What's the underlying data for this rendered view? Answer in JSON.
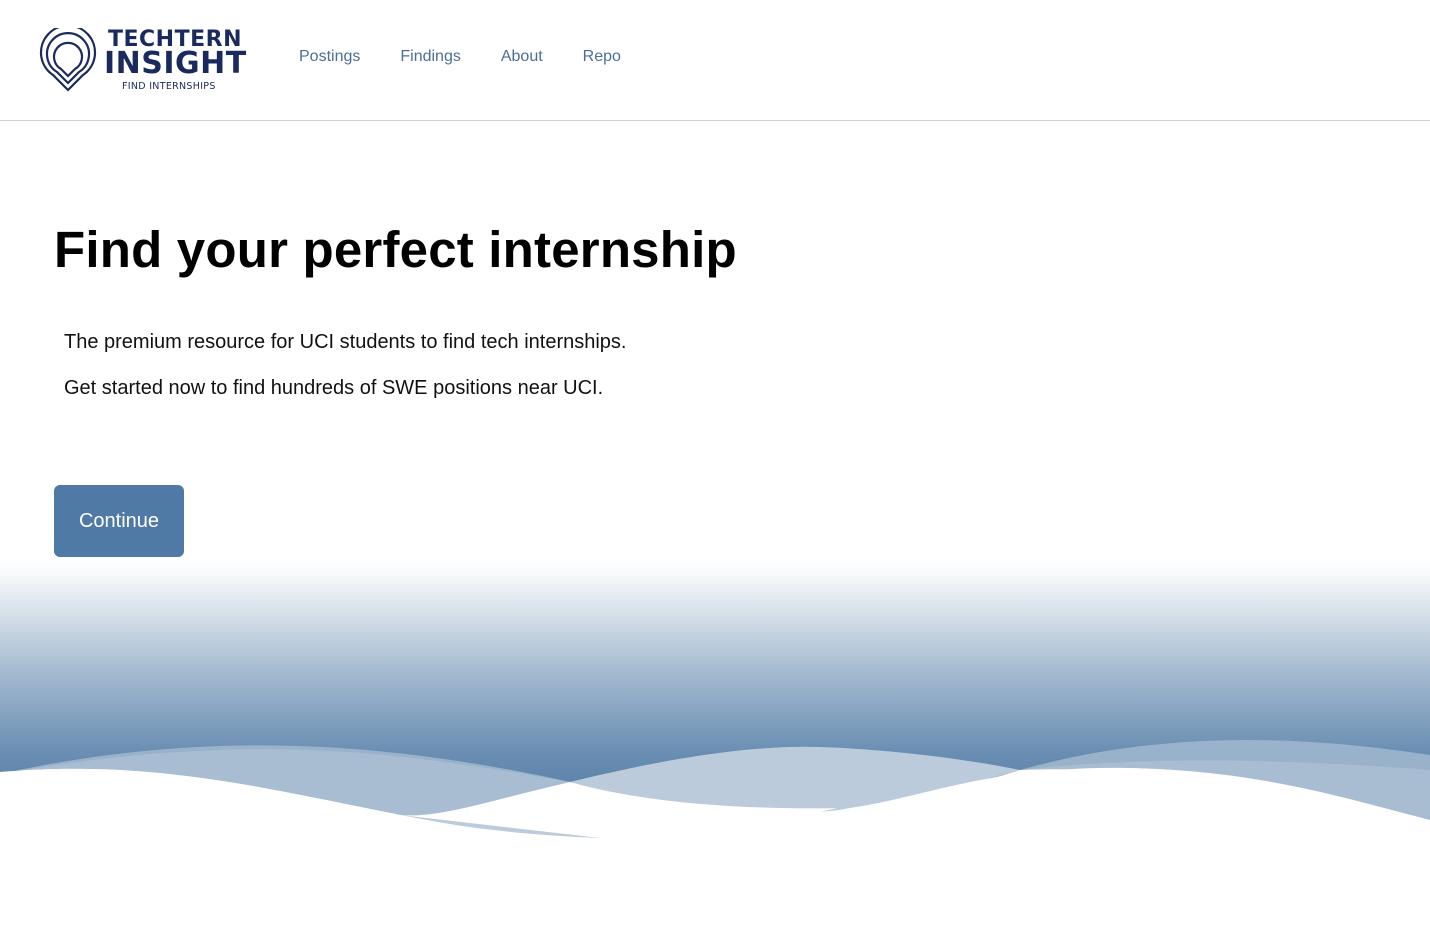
{
  "logo": {
    "line1": "TECHTERN",
    "line2": "INSIGHT",
    "tagline": "FIND INTERNSHIPS",
    "icon": "location-pin-icon",
    "color": "#1b2a5e"
  },
  "nav": {
    "items": [
      {
        "label": "Postings"
      },
      {
        "label": "Findings"
      },
      {
        "label": "About"
      },
      {
        "label": "Repo"
      }
    ],
    "link_color": "#4a6f96"
  },
  "hero": {
    "title": "Find your perfect internship",
    "line1": "The premium resource for UCI students to find tech internships.",
    "line2": "Get started now to find hundreds of SWE positions near UCI.",
    "button_label": "Continue",
    "button_color": "#4e7aa5"
  },
  "waves": {
    "colors": [
      "#5a80a8",
      "#9fb6cd",
      "#bccbdc"
    ]
  }
}
